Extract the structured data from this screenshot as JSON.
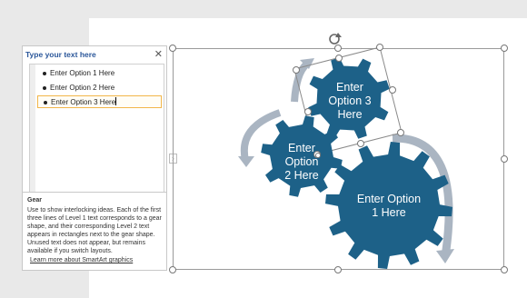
{
  "text_pane": {
    "title": "Type your text here",
    "items": [
      {
        "label": "Enter Option 1 Here"
      },
      {
        "label": "Enter Option 2 Here"
      },
      {
        "label": "Enter Option 3 Here"
      }
    ],
    "description_title": "Gear",
    "description": "Use to show interlocking ideas. Each of the first three lines of Level 1 text corresponds to a gear shape, and their corresponding Level 2 text appears in rectangles next to the gear shape. Unused text does not appear, but remains available if you switch layouts.",
    "learn_more_link": "Learn more about SmartArt graphics"
  },
  "diagram": {
    "type": "gear",
    "gear_color": "#1d6188",
    "arrow_color": "#aab5c2",
    "gears": [
      {
        "line1": "Enter Option",
        "line2": "1 Here"
      },
      {
        "line1": "Enter",
        "line2": "Option",
        "line3": "2 Here"
      },
      {
        "line1": "Enter",
        "line2": "Option 3",
        "line3": "Here"
      }
    ]
  },
  "icons": {
    "close": "close-icon",
    "rotate": "rotate-handle-icon",
    "expand": "expand-pane-icon"
  }
}
